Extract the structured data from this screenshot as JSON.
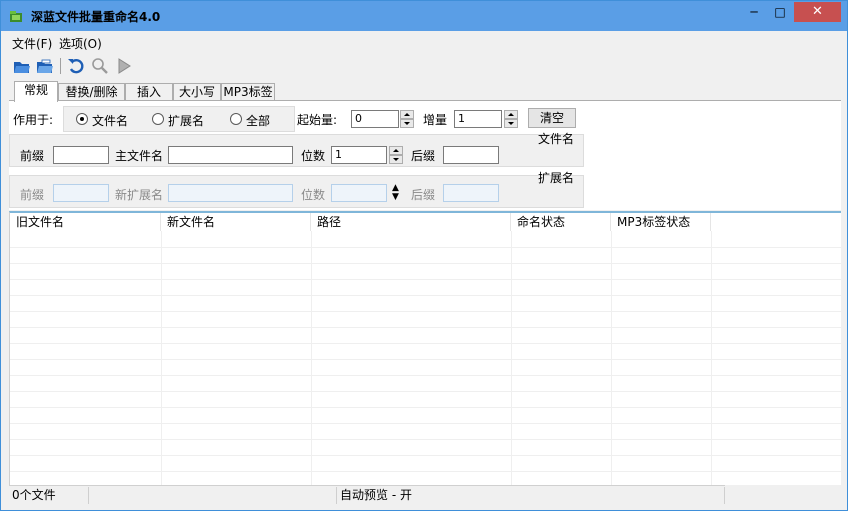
{
  "window": {
    "title": "深蓝文件批量重命名4.0",
    "minimize": "─",
    "maximize": "□",
    "close": "✕"
  },
  "menu": {
    "items": [
      "文件(F)",
      "选项(O)"
    ]
  },
  "tabs": [
    "常规",
    "替换/删除",
    "插入",
    "大小写",
    "MP3标签"
  ],
  "general": {
    "apply_label": "作用于:",
    "apply_options": [
      "文件名",
      "扩展名",
      "全部"
    ],
    "start_label": "起始量:",
    "start_value": "0",
    "increment_label": "增量",
    "increment_value": "1",
    "clear_button": "清空",
    "filename_group": {
      "title": "文件名",
      "prefix_label": "前缀",
      "prefix_value": "",
      "main_label": "主文件名",
      "main_value": "",
      "digits_label": "位数",
      "digits_value": "1",
      "suffix_label": "后缀",
      "suffix_value": ""
    },
    "extension_group": {
      "title": "扩展名",
      "prefix_label": "前缀",
      "prefix_value": "",
      "main_label": "新扩展名",
      "main_value": "",
      "digits_label": "位数",
      "digits_value": "",
      "suffix_label": "后缀",
      "suffix_value": ""
    }
  },
  "file_list": {
    "columns": [
      "旧文件名",
      "新文件名",
      "路径",
      "命名状态",
      "MP3标签状态"
    ],
    "rows": []
  },
  "status": {
    "file_count": "0个文件",
    "middle": "",
    "preview": "自动预览 - 开"
  }
}
